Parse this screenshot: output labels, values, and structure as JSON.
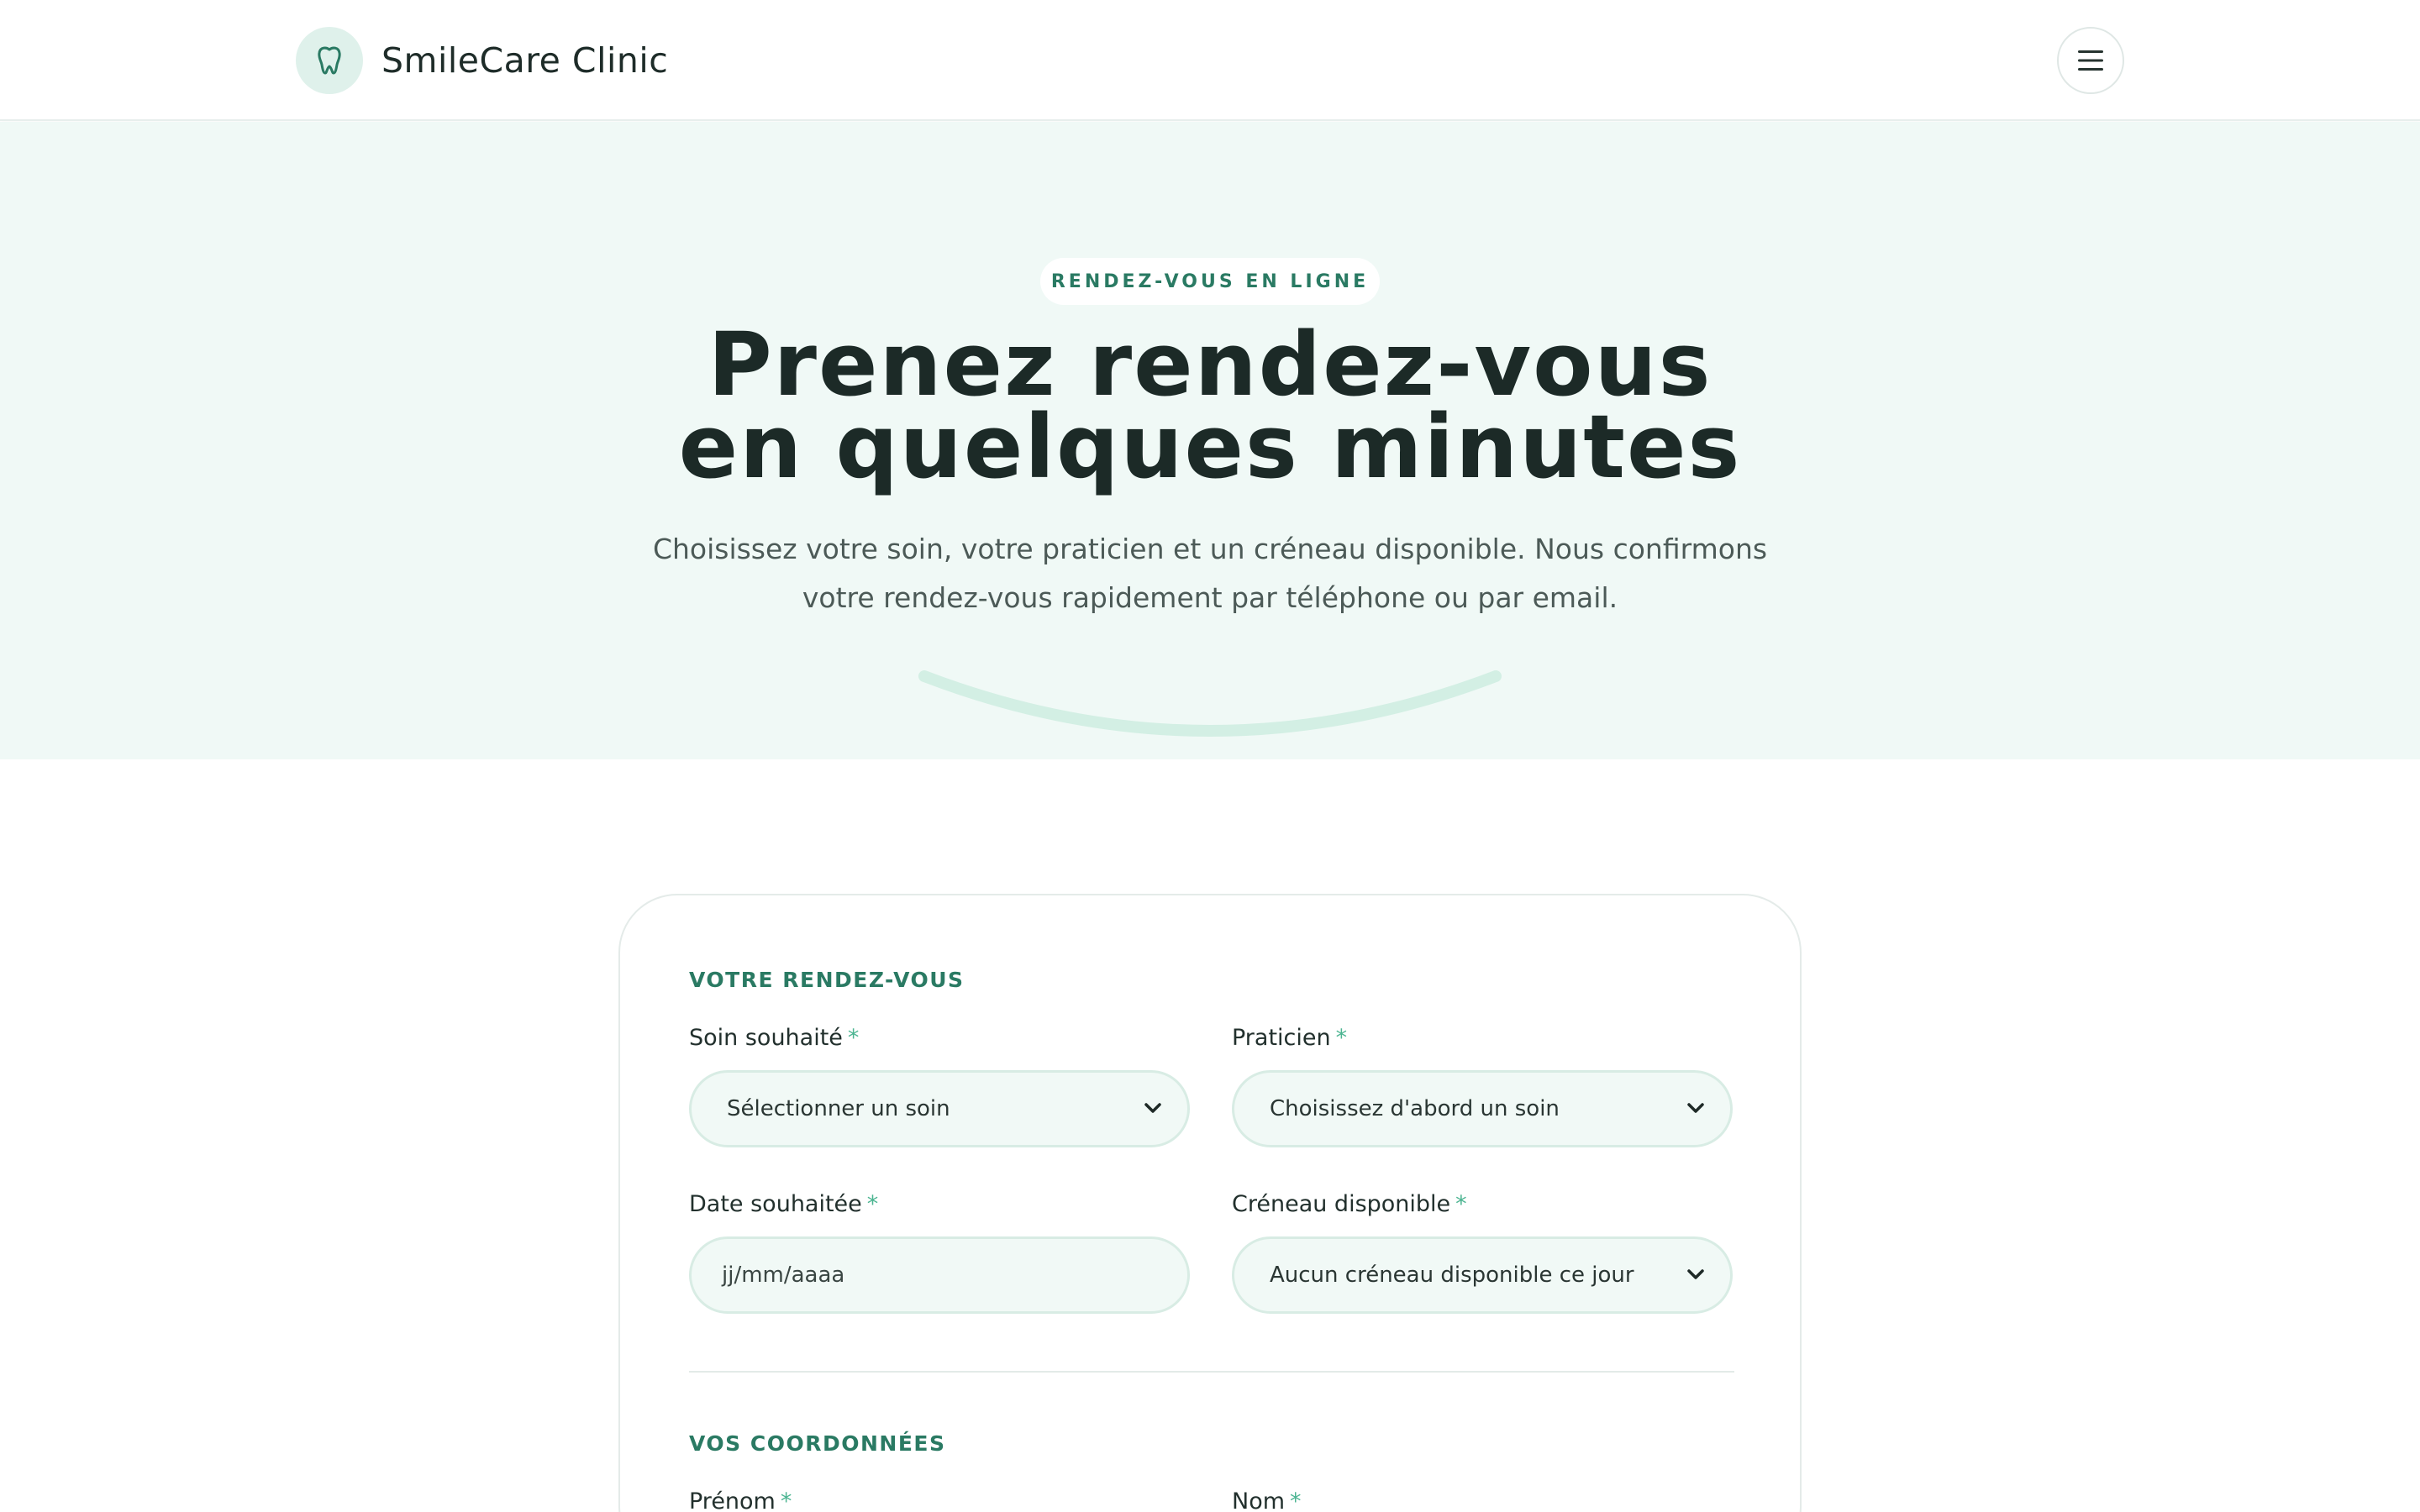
{
  "header": {
    "brand_name": "SmileCare Clinic",
    "logo_icon": "tooth-icon",
    "menu_icon": "hamburger-menu-icon"
  },
  "hero": {
    "badge": "RENDEZ-VOUS EN LIGNE",
    "title_line1": "Prenez rendez-vous",
    "title_line2": "en quelques minutes",
    "subtitle_line1": "Choisissez votre soin, votre praticien et un créneau disponible. Nous confirmons",
    "subtitle_line2": "votre rendez-vous rapidement par téléphone ou par email."
  },
  "form": {
    "section1_title": "VOTRE RENDEZ-VOUS",
    "soin": {
      "label": "Soin souhaité",
      "required": "*",
      "value": "Sélectionner un soin"
    },
    "praticien": {
      "label": "Praticien",
      "required": "*",
      "value": "Choisissez d'abord un soin"
    },
    "date": {
      "label": "Date souhaitée",
      "required": "*",
      "placeholder": "jj/mm/aaaa"
    },
    "creneau": {
      "label": "Créneau disponible",
      "required": "*",
      "value": "Aucun créneau disponible ce jour"
    },
    "section2_title": "VOS COORDONNÉES",
    "prenom": {
      "label": "Prénom",
      "required": "*"
    },
    "nom": {
      "label": "Nom",
      "required": "*"
    }
  },
  "colors": {
    "accent": "#2a7a63",
    "hero_bg": "#f0f9f6",
    "field_bg": "#f1f9f6",
    "required_star": "#4db592"
  }
}
